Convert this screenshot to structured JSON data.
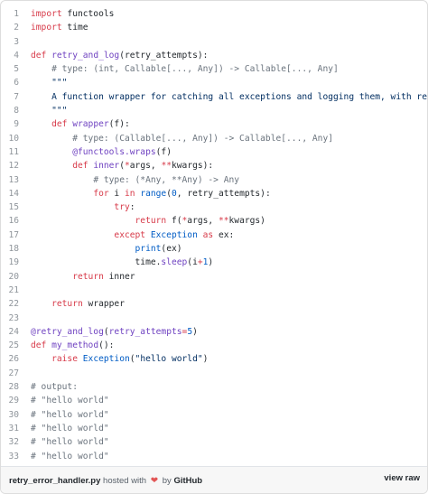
{
  "code": {
    "lines": [
      {
        "n": "1",
        "t": [
          [
            "kw",
            "import"
          ],
          [
            "pl",
            " functools"
          ]
        ]
      },
      {
        "n": "2",
        "t": [
          [
            "kw",
            "import"
          ],
          [
            "pl",
            " time"
          ]
        ]
      },
      {
        "n": "3",
        "t": []
      },
      {
        "n": "4",
        "t": [
          [
            "kw",
            "def"
          ],
          [
            "pl",
            " "
          ],
          [
            "fn",
            "retry_and_log"
          ],
          [
            "pl",
            "(retry_attempts):"
          ]
        ]
      },
      {
        "n": "5",
        "t": [
          [
            "pl",
            "    "
          ],
          [
            "cm",
            "# type: (int, Callable[..., Any]) -> Callable[..., Any]"
          ]
        ]
      },
      {
        "n": "6",
        "t": [
          [
            "pl",
            "    "
          ],
          [
            "st",
            "\"\"\""
          ]
        ]
      },
      {
        "n": "7",
        "t": [
          [
            "pl",
            "    "
          ],
          [
            "st",
            "A function wrapper for catching all exceptions and logging them, with retry attempts"
          ]
        ]
      },
      {
        "n": "8",
        "t": [
          [
            "pl",
            "    "
          ],
          [
            "st",
            "\"\"\""
          ]
        ]
      },
      {
        "n": "9",
        "t": [
          [
            "pl",
            "    "
          ],
          [
            "kw",
            "def"
          ],
          [
            "pl",
            " "
          ],
          [
            "fn",
            "wrapper"
          ],
          [
            "pl",
            "(f):"
          ]
        ]
      },
      {
        "n": "10",
        "t": [
          [
            "pl",
            "        "
          ],
          [
            "cm",
            "# type: (Callable[..., Any]) -> Callable[..., Any]"
          ]
        ]
      },
      {
        "n": "11",
        "t": [
          [
            "pl",
            "        "
          ],
          [
            "fn",
            "@functools.wraps"
          ],
          [
            "pl",
            "(f)"
          ]
        ]
      },
      {
        "n": "12",
        "t": [
          [
            "pl",
            "        "
          ],
          [
            "kw",
            "def"
          ],
          [
            "pl",
            " "
          ],
          [
            "fn",
            "inner"
          ],
          [
            "pl",
            "("
          ],
          [
            "op",
            "*"
          ],
          [
            "pl",
            "args, "
          ],
          [
            "op",
            "**"
          ],
          [
            "pl",
            "kwargs):"
          ]
        ]
      },
      {
        "n": "13",
        "t": [
          [
            "pl",
            "            "
          ],
          [
            "cm",
            "# type: (*Any, **Any) -> Any"
          ]
        ]
      },
      {
        "n": "14",
        "t": [
          [
            "pl",
            "            "
          ],
          [
            "kw",
            "for"
          ],
          [
            "pl",
            " i "
          ],
          [
            "kw",
            "in"
          ],
          [
            "pl",
            " "
          ],
          [
            "bi",
            "range"
          ],
          [
            "pl",
            "("
          ],
          [
            "nu",
            "0"
          ],
          [
            "pl",
            ", retry_attempts):"
          ]
        ]
      },
      {
        "n": "15",
        "t": [
          [
            "pl",
            "                "
          ],
          [
            "kw",
            "try"
          ],
          [
            "pl",
            ":"
          ]
        ]
      },
      {
        "n": "16",
        "t": [
          [
            "pl",
            "                    "
          ],
          [
            "kw",
            "return"
          ],
          [
            "pl",
            " f("
          ],
          [
            "op",
            "*"
          ],
          [
            "pl",
            "args, "
          ],
          [
            "op",
            "**"
          ],
          [
            "pl",
            "kwargs)"
          ]
        ]
      },
      {
        "n": "17",
        "t": [
          [
            "pl",
            "                "
          ],
          [
            "kw",
            "except"
          ],
          [
            "pl",
            " "
          ],
          [
            "bi",
            "Exception"
          ],
          [
            "pl",
            " "
          ],
          [
            "kw",
            "as"
          ],
          [
            "pl",
            " ex:"
          ]
        ]
      },
      {
        "n": "18",
        "t": [
          [
            "pl",
            "                    "
          ],
          [
            "bi",
            "print"
          ],
          [
            "pl",
            "(ex)"
          ]
        ]
      },
      {
        "n": "19",
        "t": [
          [
            "pl",
            "                    time."
          ],
          [
            "fn",
            "sleep"
          ],
          [
            "pl",
            "(i"
          ],
          [
            "op",
            "+"
          ],
          [
            "nu",
            "1"
          ],
          [
            "pl",
            ")"
          ]
        ]
      },
      {
        "n": "20",
        "t": [
          [
            "pl",
            "        "
          ],
          [
            "kw",
            "return"
          ],
          [
            "pl",
            " inner"
          ]
        ]
      },
      {
        "n": "21",
        "t": []
      },
      {
        "n": "22",
        "t": [
          [
            "pl",
            "    "
          ],
          [
            "kw",
            "return"
          ],
          [
            "pl",
            " wrapper"
          ]
        ]
      },
      {
        "n": "23",
        "t": []
      },
      {
        "n": "24",
        "t": [
          [
            "fn",
            "@retry_and_log"
          ],
          [
            "pl",
            "("
          ],
          [
            "fn",
            "retry_attempts"
          ],
          [
            "op",
            "="
          ],
          [
            "nu",
            "5"
          ],
          [
            "pl",
            ")"
          ]
        ]
      },
      {
        "n": "25",
        "t": [
          [
            "kw",
            "def"
          ],
          [
            "pl",
            " "
          ],
          [
            "fn",
            "my_method"
          ],
          [
            "pl",
            "():"
          ]
        ]
      },
      {
        "n": "26",
        "t": [
          [
            "pl",
            "    "
          ],
          [
            "kw",
            "raise"
          ],
          [
            "pl",
            " "
          ],
          [
            "bi",
            "Exception"
          ],
          [
            "pl",
            "("
          ],
          [
            "st",
            "\"hello world\""
          ],
          [
            "pl",
            ")"
          ]
        ]
      },
      {
        "n": "27",
        "t": []
      },
      {
        "n": "28",
        "t": [
          [
            "cm",
            "# output:"
          ]
        ]
      },
      {
        "n": "29",
        "t": [
          [
            "cm",
            "# \"hello world\""
          ]
        ]
      },
      {
        "n": "30",
        "t": [
          [
            "cm",
            "# \"hello world\""
          ]
        ]
      },
      {
        "n": "31",
        "t": [
          [
            "cm",
            "# \"hello world\""
          ]
        ]
      },
      {
        "n": "32",
        "t": [
          [
            "cm",
            "# \"hello world\""
          ]
        ]
      },
      {
        "n": "33",
        "t": [
          [
            "cm",
            "# \"hello world\""
          ]
        ]
      }
    ]
  },
  "footer": {
    "filename": "retry_error_handler.py",
    "hosted_with": "hosted with",
    "heart": "❤",
    "by": "by",
    "github": "GitHub",
    "view_raw": "view raw"
  },
  "colors": {
    "keyword": "#d73a49",
    "function": "#6f42c1",
    "comment": "#6a737d",
    "string": "#032f62",
    "number": "#005cc5",
    "heart": "#e25555"
  }
}
